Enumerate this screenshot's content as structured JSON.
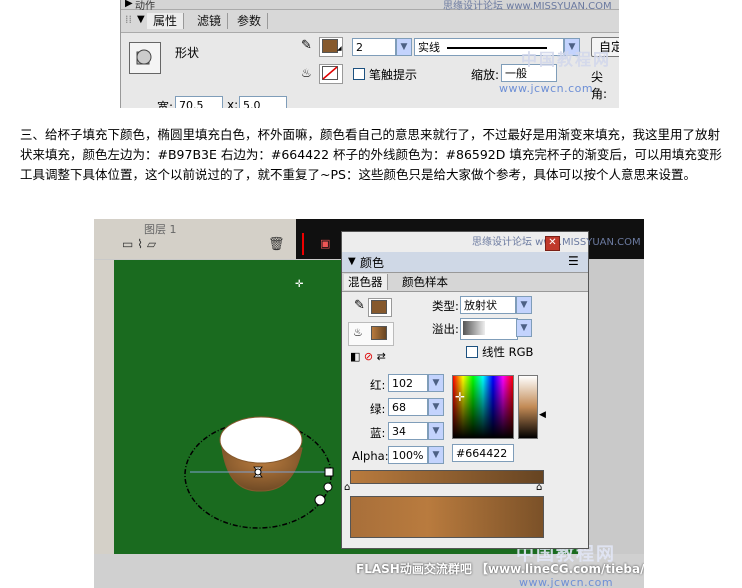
{
  "top_panel": {
    "strip_label": "动作",
    "tabs": [
      "属性",
      "滤镜",
      "参数"
    ],
    "watermark": "思缘设计论坛 www.MISSYUAN.COM",
    "shape_label": "形状",
    "stroke_height_value": "2",
    "stroke_style_value": "实线",
    "custom_button": "自定",
    "stroke_hint_label": "笔触提示",
    "scale_label": "缩放:",
    "scale_value": "一般",
    "corner_label": "尖角:",
    "width_label": "宽:",
    "width_value": "70.5",
    "x_label": "x:",
    "x_value": "5.0",
    "site_logo": "中国教程网",
    "site_url": "www.jcwcn.com",
    "colors": {
      "stroke_swatch": "#86592D"
    }
  },
  "paragraph": "三、给杯子填充下颜色，椭圆里填充白色，杯外面嘛，颜色看自己的意思来就行了，不过最好是用渐变来填充，我这里用了放射状来填充，颜色左边为：#B97B3E 右边为：#664422 杯子的外线颜色为：#86592D 填充完杯子的渐变后，可以用填充变形工具调整下具体位置，这个以前说过的了，就不重复了~PS：这些颜色只是给大家做个参考，具体可以按个人意思来设置。",
  "flash": {
    "layer_label": "图层 1",
    "watermark": "思缘设计论坛 www.MISSYUAN.COM",
    "color_panel": {
      "title": "颜色",
      "tabs": [
        "混色器",
        "颜色样本"
      ],
      "type_label": "类型:",
      "type_value": "放射状",
      "overflow_label": "溢出:",
      "linear_rgb_label": "线性 RGB",
      "red_label": "红:",
      "red_value": "102",
      "green_label": "绿:",
      "green_value": "68",
      "blue_label": "蓝:",
      "blue_value": "34",
      "alpha_label": "Alpha:",
      "alpha_value": "100%",
      "hex_value": "#664422",
      "watermark": "思缘设计论坛 www.MISSYUAN.COM"
    },
    "bottom_logo": "中国教程网",
    "bottom_caption": "FLASH动画交流群吧 【www.lineCG.com/tieba/1856】",
    "bottom_url": "www.jcwcn.com",
    "colors": {
      "stage_green": "#1a6b1f",
      "gradient_left": "#B97B3E",
      "gradient_right": "#664422",
      "cup_stroke": "#86592D"
    }
  }
}
